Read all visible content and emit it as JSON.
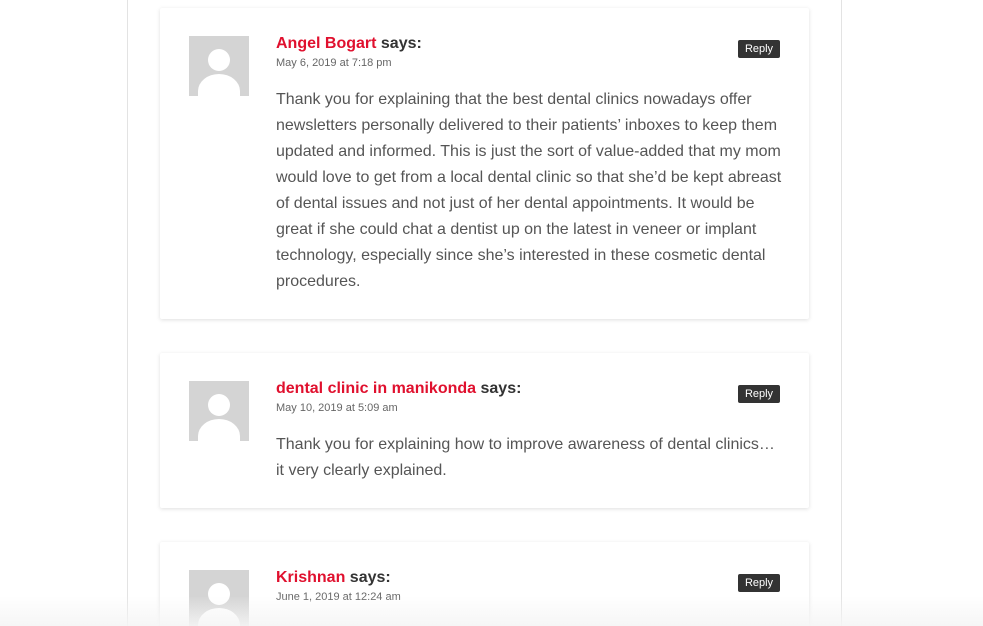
{
  "comments": [
    {
      "author": "Angel Bogart",
      "says": "says:",
      "date": "May 6, 2019 at 7:18 pm",
      "reply_label": "Reply",
      "body": "Thank you for explaining that the best dental clinics nowadays offer newsletters personally delivered to their patients’ inboxes to keep them updated and informed. This is just the sort of value-added that my mom would love to get from a local dental clinic so that she’d be kept abreast of dental issues and not just of her dental appointments. It would be great if she could chat a dentist up on the latest in veneer or implant technology, especially since she’s interested in these cosmetic dental procedures."
    },
    {
      "author": "dental clinic in manikonda",
      "says": "says:",
      "date": "May 10, 2019 at 5:09 am",
      "reply_label": "Reply",
      "body": "Thank you for explaining how to improve awareness of dental clinics… it very clearly explained."
    },
    {
      "author": "Krishnan",
      "says": "says:",
      "date": "June 1, 2019 at 12:24 am",
      "reply_label": "Reply",
      "body": ""
    }
  ],
  "colors": {
    "author_link": "#e0102e",
    "reply_button_bg": "#333333",
    "avatar_placeholder": "#d4d4d4",
    "body_text": "#555555"
  },
  "icons": {
    "avatar": "default-user-silhouette-icon"
  }
}
